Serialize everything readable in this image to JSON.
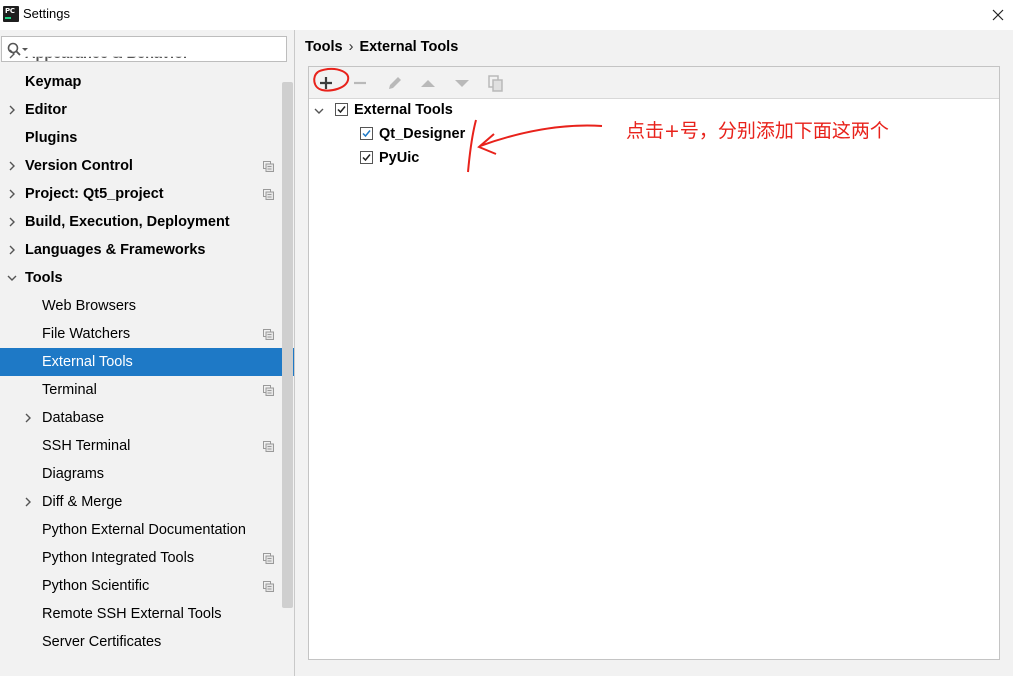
{
  "window": {
    "title": "Settings",
    "app_icon_text": "PC"
  },
  "search": {
    "placeholder": "",
    "value": ""
  },
  "sidebar": {
    "items": [
      {
        "label": "Appearance & Behavior",
        "bold": true,
        "expandable": true,
        "expanded": false,
        "level": 0,
        "project": false,
        "partial": true
      },
      {
        "label": "Keymap",
        "bold": true,
        "expandable": false,
        "level": 0,
        "project": false
      },
      {
        "label": "Editor",
        "bold": true,
        "expandable": true,
        "expanded": false,
        "level": 0,
        "project": false
      },
      {
        "label": "Plugins",
        "bold": true,
        "expandable": false,
        "level": 0,
        "project": false
      },
      {
        "label": "Version Control",
        "bold": true,
        "expandable": true,
        "expanded": false,
        "level": 0,
        "project": true
      },
      {
        "label": "Project: Qt5_project",
        "bold": true,
        "expandable": true,
        "expanded": false,
        "level": 0,
        "project": true
      },
      {
        "label": "Build, Execution, Deployment",
        "bold": true,
        "expandable": true,
        "expanded": false,
        "level": 0,
        "project": false
      },
      {
        "label": "Languages & Frameworks",
        "bold": true,
        "expandable": true,
        "expanded": false,
        "level": 0,
        "project": false
      },
      {
        "label": "Tools",
        "bold": true,
        "expandable": true,
        "expanded": true,
        "level": 0,
        "project": false
      },
      {
        "label": "Web Browsers",
        "bold": false,
        "expandable": false,
        "level": 1,
        "project": false
      },
      {
        "label": "File Watchers",
        "bold": false,
        "expandable": false,
        "level": 1,
        "project": true
      },
      {
        "label": "External Tools",
        "bold": false,
        "expandable": false,
        "level": 1,
        "project": false,
        "selected": true
      },
      {
        "label": "Terminal",
        "bold": false,
        "expandable": false,
        "level": 1,
        "project": true
      },
      {
        "label": "Database",
        "bold": false,
        "expandable": true,
        "expanded": false,
        "level": 1,
        "project": false
      },
      {
        "label": "SSH Terminal",
        "bold": false,
        "expandable": false,
        "level": 1,
        "project": true
      },
      {
        "label": "Diagrams",
        "bold": false,
        "expandable": false,
        "level": 1,
        "project": false
      },
      {
        "label": "Diff & Merge",
        "bold": false,
        "expandable": true,
        "expanded": false,
        "level": 1,
        "project": false
      },
      {
        "label": "Python External Documentation",
        "bold": false,
        "expandable": false,
        "level": 1,
        "project": false
      },
      {
        "label": "Python Integrated Tools",
        "bold": false,
        "expandable": false,
        "level": 1,
        "project": true
      },
      {
        "label": "Python Scientific",
        "bold": false,
        "expandable": false,
        "level": 1,
        "project": true
      },
      {
        "label": "Remote SSH External Tools",
        "bold": false,
        "expandable": false,
        "level": 1,
        "project": false
      },
      {
        "label": "Server Certificates",
        "bold": false,
        "expandable": false,
        "level": 1,
        "project": false
      }
    ]
  },
  "breadcrumb": {
    "parent": "Tools",
    "separator": "›",
    "current": "External Tools"
  },
  "toolbar": {
    "buttons": [
      {
        "name": "add",
        "icon": "plus-icon",
        "enabled": true
      },
      {
        "name": "remove",
        "icon": "minus-icon",
        "enabled": false
      },
      {
        "name": "edit",
        "icon": "pencil-icon",
        "enabled": false
      },
      {
        "name": "move-up",
        "icon": "arrow-up-icon",
        "enabled": false
      },
      {
        "name": "move-down",
        "icon": "arrow-down-icon",
        "enabled": false
      },
      {
        "name": "copy",
        "icon": "copy-icon",
        "enabled": false
      }
    ]
  },
  "tools_tree": {
    "group": {
      "label": "External Tools",
      "checked": true,
      "expanded": true
    },
    "children": [
      {
        "label": "Qt_Designer",
        "checked": true
      },
      {
        "label": "PyUic",
        "checked": true
      }
    ]
  },
  "annotation": {
    "text": "点击+号，分别添加下面这两个",
    "color": "#e8221b"
  },
  "colors": {
    "selection": "#1e79c6",
    "background": "#f2f2f2",
    "annotation": "#e8221b"
  }
}
